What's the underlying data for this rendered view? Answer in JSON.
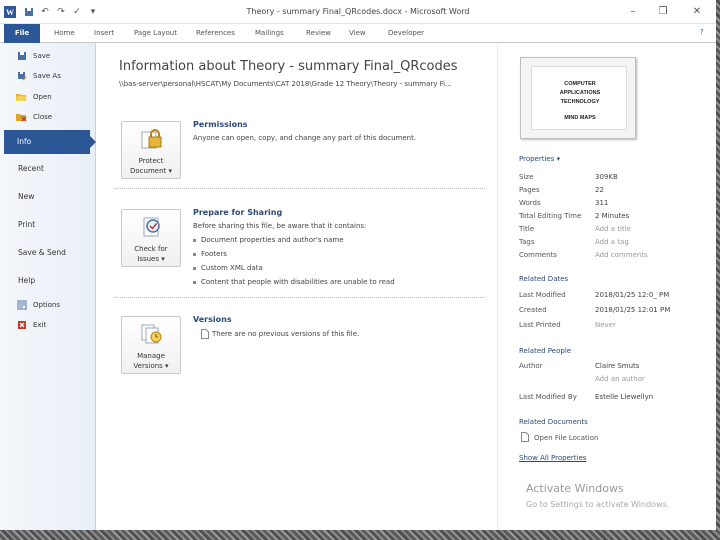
{
  "window": {
    "title": "Theory - summary Final_QRcodes.docx - Microsoft Word",
    "app_logo": "W"
  },
  "ribbon": {
    "file": "File",
    "tabs": [
      "Home",
      "Insert",
      "Page Layout",
      "References",
      "Mailings",
      "Review",
      "View",
      "Developer"
    ]
  },
  "nav": {
    "save": "Save",
    "save_as": "Save As",
    "open": "Open",
    "close": "Close",
    "info": "Info",
    "recent": "Recent",
    "new": "New",
    "print": "Print",
    "save_send": "Save & Send",
    "help": "Help",
    "options": "Options",
    "exit": "Exit"
  },
  "info": {
    "heading": "Information about Theory - summary Final_QRcodes",
    "path": "\\\\bas-server\\personal\\HSCAT\\My Documents\\CAT 2018\\Grade 12 Theory\\Theory - summary Fi...",
    "permissions": {
      "button": [
        "Protect",
        "Document ▾"
      ],
      "title": "Permissions",
      "desc": "Anyone can open, copy, and change any part of this document."
    },
    "prepare": {
      "button": [
        "Check for",
        "Issues ▾"
      ],
      "title": "Prepare for Sharing",
      "desc": "Before sharing this file, be aware that it contains:",
      "bullets": [
        "Document properties and author's name",
        "Footers",
        "Custom XML data",
        "Content that people with disabilities are unable to read"
      ]
    },
    "versions": {
      "button": [
        "Manage",
        "Versions ▾"
      ],
      "title": "Versions",
      "desc": "There are no previous versions of this file."
    }
  },
  "thumbnail": {
    "lines": [
      "COMPUTER",
      "APPLICATIONS",
      "TECHNOLOGY",
      "MIND MAPS"
    ]
  },
  "properties": {
    "header": "Properties ▾",
    "rows": [
      {
        "label": "Size",
        "value": "309KB"
      },
      {
        "label": "Pages",
        "value": "22"
      },
      {
        "label": "Words",
        "value": "311"
      },
      {
        "label": "Total Editing Time",
        "value": "2 Minutes"
      },
      {
        "label": "Title",
        "value": "Add a title"
      },
      {
        "label": "Tags",
        "value": "Add a tag"
      },
      {
        "label": "Comments",
        "value": "Add comments"
      }
    ]
  },
  "related_dates": {
    "header": "Related Dates",
    "rows": [
      {
        "label": "Last Modified",
        "value": "2018/01/25 12:0_ PM"
      },
      {
        "label": "Created",
        "value": "2018/01/25 12:01 PM"
      },
      {
        "label": "Last Printed",
        "value": "Never"
      }
    ]
  },
  "related_people": {
    "header": "Related People",
    "author_label": "Author",
    "author_value": "Claire Smuts",
    "add_author": "Add an author",
    "modified_by_label": "Last Modified By",
    "modified_by_value": "Estelle Llewellyn"
  },
  "related_documents": {
    "header": "Related Documents",
    "open_location": "Open File Location",
    "show_all": "Show All Properties"
  },
  "watermark": {
    "line1": "Activate Windows",
    "line2": "Go to Settings to activate Windows."
  },
  "colors": {
    "accent": "#2b5797",
    "heading": "#2b4a7a"
  }
}
